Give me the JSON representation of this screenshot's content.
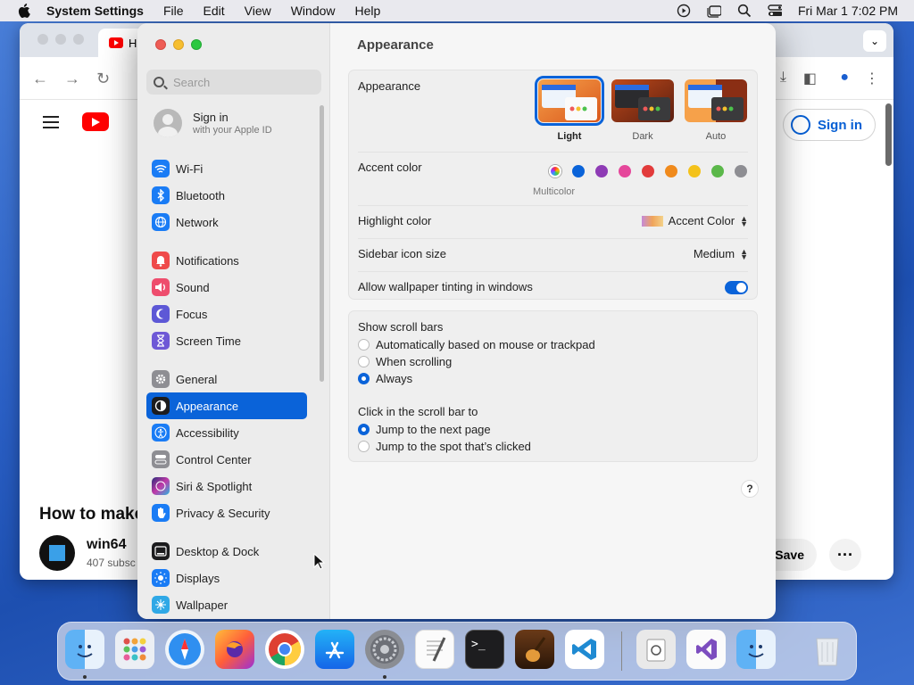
{
  "menubar": {
    "app_name": "System Settings",
    "menus": [
      "File",
      "Edit",
      "View",
      "Window",
      "Help"
    ],
    "clock": "Fri Mar 1  7:02 PM"
  },
  "browser": {
    "tab_title": "H",
    "video_title": "How to make",
    "channel_name": "win64",
    "subscribers": "407 subsc",
    "sign_in": "Sign in",
    "save": "Save"
  },
  "sidebar": {
    "search_placeholder": "Search",
    "account_title": "Sign in",
    "account_subtitle": "with your Apple ID",
    "items": [
      {
        "label": "Wi-Fi",
        "icon": "wifi-icon",
        "color": "#1a7cf5"
      },
      {
        "label": "Bluetooth",
        "icon": "bluetooth-icon",
        "color": "#1a7cf5"
      },
      {
        "label": "Network",
        "icon": "globe-icon",
        "color": "#1a7cf5"
      },
      {
        "label": "Notifications",
        "icon": "bell-icon",
        "color": "#ef4a4a"
      },
      {
        "label": "Sound",
        "icon": "speaker-icon",
        "color": "#ee4d6d"
      },
      {
        "label": "Focus",
        "icon": "moon-icon",
        "color": "#5d58d6"
      },
      {
        "label": "Screen Time",
        "icon": "hourglass-icon",
        "color": "#6e58d6"
      },
      {
        "label": "General",
        "icon": "gear-icon",
        "color": "#8e8e93"
      },
      {
        "label": "Appearance",
        "icon": "appearance-icon",
        "color": "#1c1c1e"
      },
      {
        "label": "Accessibility",
        "icon": "accessibility-icon",
        "color": "#1a7cf5"
      },
      {
        "label": "Control Center",
        "icon": "control-center-icon",
        "color": "#8e8e93"
      },
      {
        "label": "Siri & Spotlight",
        "icon": "siri-icon",
        "color": "#7a3fd0"
      },
      {
        "label": "Privacy & Security",
        "icon": "hand-icon",
        "color": "#1a7cf5"
      },
      {
        "label": "Desktop & Dock",
        "icon": "dock-icon",
        "color": "#1c1c1e"
      },
      {
        "label": "Displays",
        "icon": "sun-icon",
        "color": "#1a7cf5"
      },
      {
        "label": "Wallpaper",
        "icon": "wallpaper-icon",
        "color": "#2fa8e6"
      }
    ],
    "selected": "Appearance"
  },
  "main": {
    "title": "Appearance",
    "appearance_label": "Appearance",
    "appearance_options": [
      "Light",
      "Dark",
      "Auto"
    ],
    "appearance_selected": "Light",
    "accent_label": "Accent color",
    "accent_colors": [
      "multicolor",
      "#0a63d9",
      "#8e3bb5",
      "#e5479b",
      "#e23b3b",
      "#f08a1c",
      "#f4c21b",
      "#5bb84a",
      "#8e8e93"
    ],
    "accent_selected_label": "Multicolor",
    "highlight_label": "Highlight color",
    "highlight_value": "Accent Color",
    "icon_size_label": "Sidebar icon size",
    "icon_size_value": "Medium",
    "tinting_label": "Allow wallpaper tinting in windows",
    "tinting_on": true,
    "scroll_bars_label": "Show scroll bars",
    "scroll_bars_options": [
      "Automatically based on mouse or trackpad",
      "When scrolling",
      "Always"
    ],
    "scroll_bars_selected": "Always",
    "click_label": "Click in the scroll bar to",
    "click_options": [
      "Jump to the next page",
      "Jump to the spot that’s clicked"
    ],
    "click_selected": "Jump to the next page",
    "help": "?"
  },
  "dock": {
    "apps": [
      "finder-icon",
      "launchpad-icon",
      "safari-icon",
      "firefox-icon",
      "chrome-icon",
      "app-store-icon",
      "system-settings-icon",
      "textedit-icon",
      "terminal-icon",
      "garageband-icon",
      "vscode-icon",
      "preview-icon",
      "visual-studio-icon",
      "finder-doc-icon",
      "trash-icon"
    ]
  }
}
